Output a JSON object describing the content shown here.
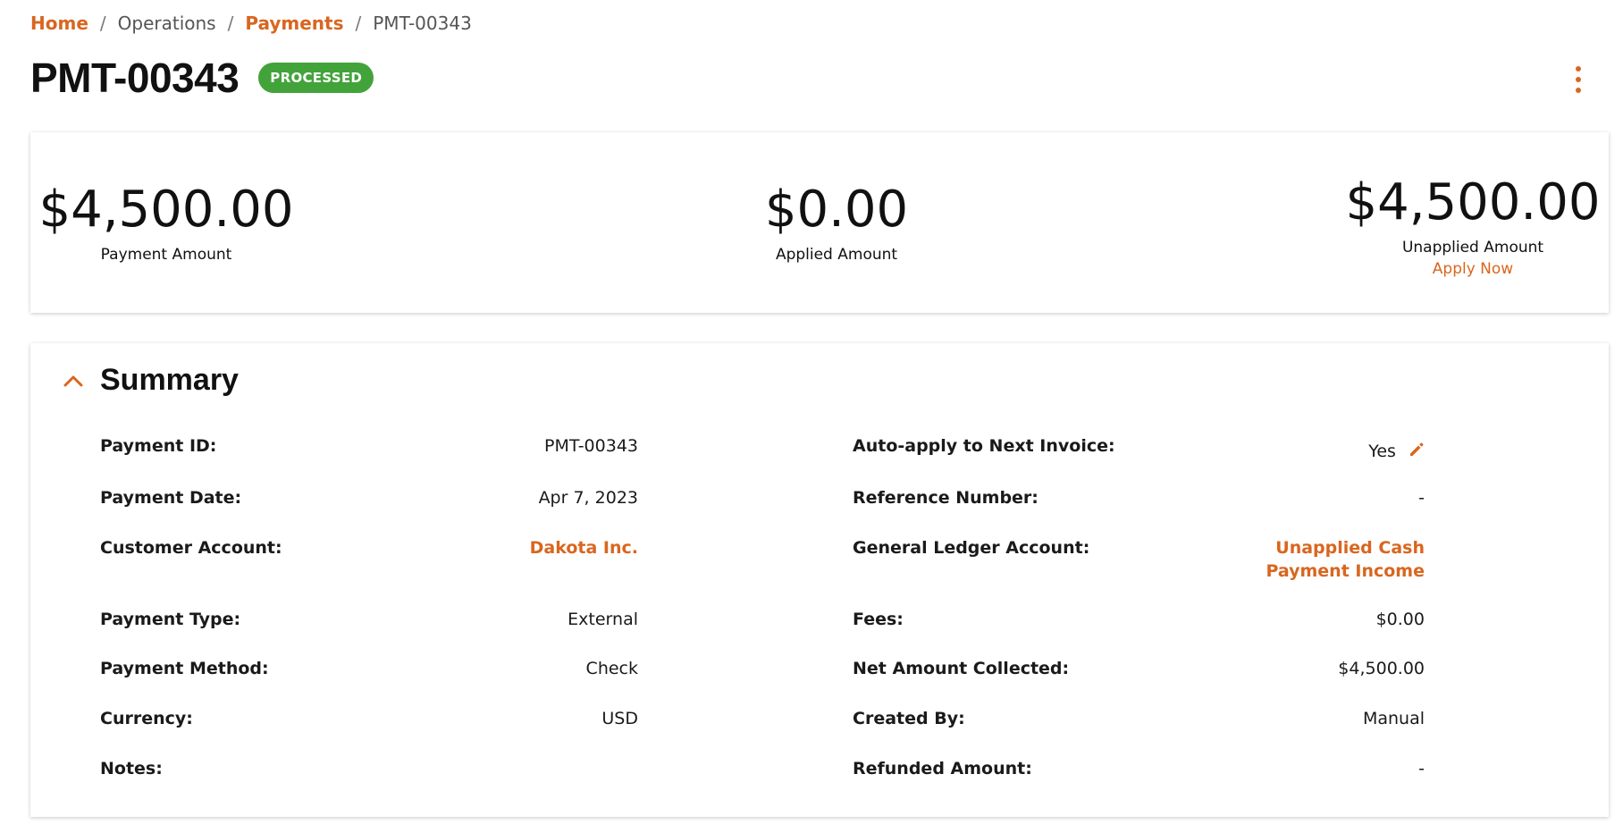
{
  "breadcrumb": {
    "home": "Home",
    "operations": "Operations",
    "payments": "Payments",
    "current": "PMT-00343",
    "separator": "/"
  },
  "header": {
    "title": "PMT-00343",
    "status": "PROCESSED",
    "menu_icon": "kebab-menu-icon"
  },
  "metrics": {
    "payment_amount": {
      "value": "$4,500.00",
      "label": "Payment Amount"
    },
    "applied_amount": {
      "value": "$0.00",
      "label": "Applied Amount"
    },
    "unapplied_amount": {
      "value": "$4,500.00",
      "label": "Unapplied Amount",
      "action": "Apply Now"
    }
  },
  "summary": {
    "title": "Summary",
    "collapse_icon": "chevron-up-icon",
    "left": [
      {
        "label": "Payment ID:",
        "value": "PMT-00343"
      },
      {
        "label": "Payment Date:",
        "value": "Apr 7, 2023"
      },
      {
        "label": "Customer Account:",
        "value": "Dakota Inc."
      },
      {
        "label": "Payment Type:",
        "value": "External"
      },
      {
        "label": "Payment Method:",
        "value": "Check"
      },
      {
        "label": "Currency:",
        "value": "USD"
      },
      {
        "label": "Notes:",
        "value": ""
      }
    ],
    "right": [
      {
        "label": "Auto-apply to Next Invoice:",
        "value": "Yes"
      },
      {
        "label": "Reference Number:",
        "value": "-"
      },
      {
        "label": "General Ledger Account:",
        "value": "Unapplied Cash",
        "value2": "Payment Income"
      },
      {
        "label": "Fees:",
        "value": "$0.00"
      },
      {
        "label": "Net Amount Collected:",
        "value": "$4,500.00"
      },
      {
        "label": "Created By:",
        "value": "Manual"
      },
      {
        "label": "Refunded Amount:",
        "value": "-"
      }
    ]
  },
  "colors": {
    "accent": "#d9661f",
    "status_green": "#43a33b",
    "text": "#1a1a1a"
  }
}
